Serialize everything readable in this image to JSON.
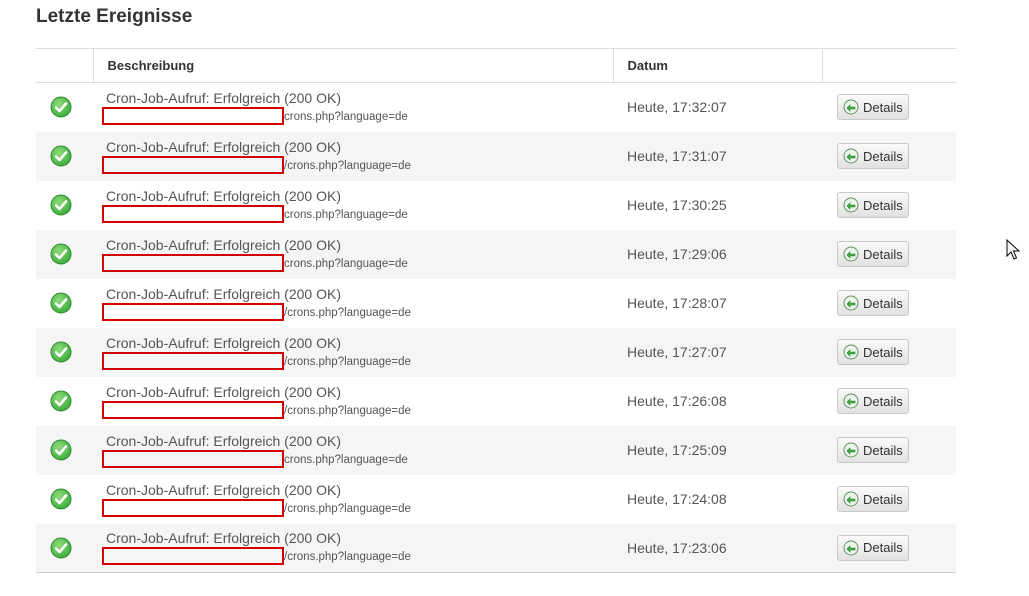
{
  "section": {
    "title": "Letzte Ereignisse"
  },
  "table": {
    "headers": {
      "status": "",
      "description": "Beschreibung",
      "date": "Datum",
      "actions": ""
    },
    "rows": [
      {
        "status_icon": "check-circle-icon",
        "description": "Cron-Job-Aufruf: Erfolgreich (200 OK)",
        "url_suffix": "crons.php?language=de",
        "date": "Heute, 17:32:07",
        "button": "Details"
      },
      {
        "status_icon": "check-circle-icon",
        "description": "Cron-Job-Aufruf: Erfolgreich (200 OK)",
        "url_suffix": "/crons.php?language=de",
        "date": "Heute, 17:31:07",
        "button": "Details"
      },
      {
        "status_icon": "check-circle-icon",
        "description": "Cron-Job-Aufruf: Erfolgreich (200 OK)",
        "url_suffix": "crons.php?language=de",
        "date": "Heute, 17:30:25",
        "button": "Details"
      },
      {
        "status_icon": "check-circle-icon",
        "description": "Cron-Job-Aufruf: Erfolgreich (200 OK)",
        "url_suffix": "crons.php?language=de",
        "date": "Heute, 17:29:06",
        "button": "Details"
      },
      {
        "status_icon": "check-circle-icon",
        "description": "Cron-Job-Aufruf: Erfolgreich (200 OK)",
        "url_suffix": "/crons.php?language=de",
        "date": "Heute, 17:28:07",
        "button": "Details"
      },
      {
        "status_icon": "check-circle-icon",
        "description": "Cron-Job-Aufruf: Erfolgreich (200 OK)",
        "url_suffix": "/crons.php?language=de",
        "date": "Heute, 17:27:07",
        "button": "Details"
      },
      {
        "status_icon": "check-circle-icon",
        "description": "Cron-Job-Aufruf: Erfolgreich (200 OK)",
        "url_suffix": "/crons.php?language=de",
        "date": "Heute, 17:26:08",
        "button": "Details"
      },
      {
        "status_icon": "check-circle-icon",
        "description": "Cron-Job-Aufruf: Erfolgreich (200 OK)",
        "url_suffix": "crons.php?language=de",
        "date": "Heute, 17:25:09",
        "button": "Details"
      },
      {
        "status_icon": "check-circle-icon",
        "description": "Cron-Job-Aufruf: Erfolgreich (200 OK)",
        "url_suffix": "/crons.php?language=de",
        "date": "Heute, 17:24:08",
        "button": "Details"
      },
      {
        "status_icon": "check-circle-icon",
        "description": "Cron-Job-Aufruf: Erfolgreich (200 OK)",
        "url_suffix": "/crons.php?language=de",
        "date": "Heute, 17:23:06",
        "button": "Details"
      }
    ]
  },
  "colors": {
    "success_green": "#3fae3f",
    "redaction_red": "#d40000",
    "row_stripe": "#f5f5f5"
  }
}
